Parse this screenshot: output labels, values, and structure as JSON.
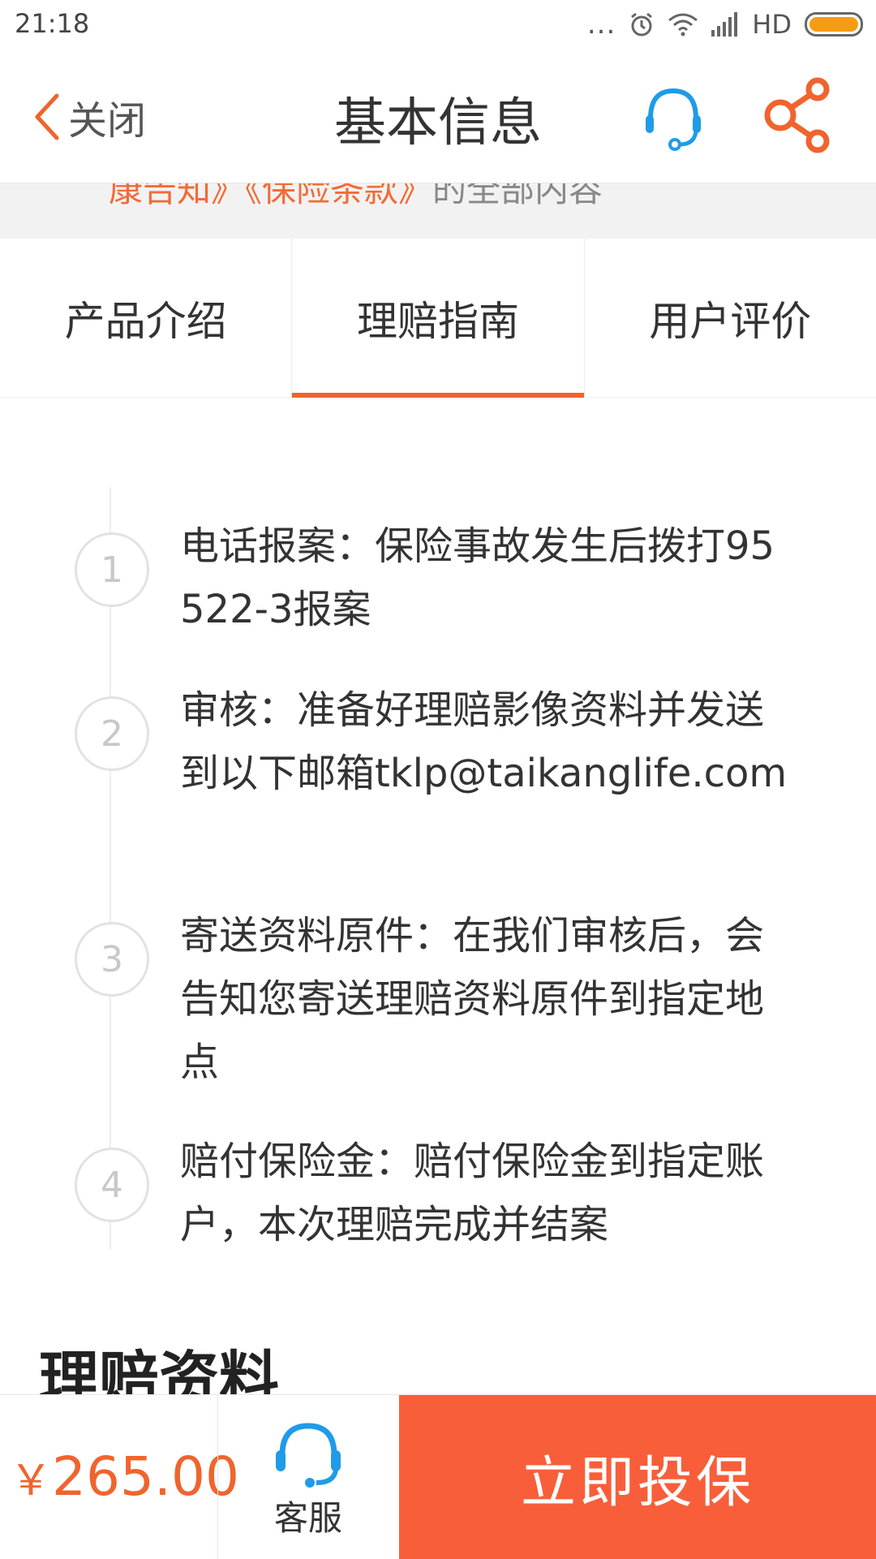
{
  "status_bar": {
    "time": "21:18",
    "dots": "...",
    "network": "HD",
    "icons": [
      "alarm-icon",
      "wifi-icon",
      "signal-icon",
      "battery-icon"
    ]
  },
  "nav": {
    "back_label": "关闭",
    "title": "基本信息",
    "icons": [
      "chevron-left-icon",
      "headset-icon",
      "share-icon"
    ]
  },
  "notice": {
    "part1": "康告知》《保险条款》",
    "part2": "的全部内容"
  },
  "tabs": [
    {
      "label": "产品介绍",
      "active": false
    },
    {
      "label": "理赔指南",
      "active": true
    },
    {
      "label": "用户评价",
      "active": false
    }
  ],
  "steps": [
    {
      "num": "1",
      "text": "电话报案：保险事故发生后拨打95522-3报案"
    },
    {
      "num": "2",
      "text": "审核：准备好理赔影像资料并发送到以下邮箱tklp@taikanglife.com"
    },
    {
      "num": "3",
      "text": "寄送资料原件：在我们审核后，会告知您寄送理赔资料原件到指定地点"
    },
    {
      "num": "4",
      "text": "赔付保险金：赔付保险金到指定账户，本次理赔完成并结案"
    }
  ],
  "section": {
    "title": "理赔资料"
  },
  "bottom": {
    "currency": "￥",
    "price": "265.00",
    "service_label": "客服",
    "buy_label": "立即投保"
  },
  "colors": {
    "accent": "#f0642d",
    "buy_button": "#f95e3a",
    "service_icon": "#1f9be8"
  }
}
